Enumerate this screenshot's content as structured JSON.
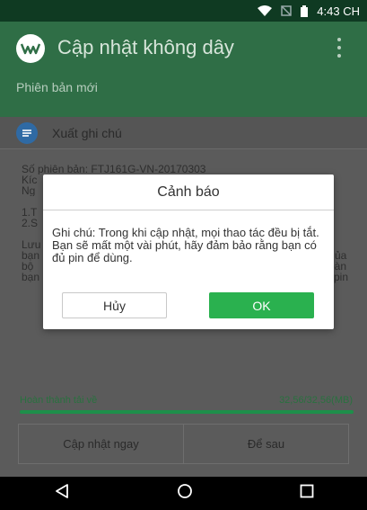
{
  "status_bar": {
    "time": "4:43 CH"
  },
  "app_bar": {
    "title": "Cập nhật không dây",
    "subtitle": "Phiên bản mới"
  },
  "notes": {
    "label": "Xuất ghi chú"
  },
  "info": {
    "lines": [
      "Số phiên bản: FTJ161G-VN-20170303",
      "Kíc",
      "Ng",
      "",
      "1.T",
      "2.S",
      "",
      "Lưu",
      "bạn",
      "bộ",
      "bạn"
    ],
    "right_fragments": [
      "ủa",
      "oàn",
      "pin"
    ]
  },
  "download": {
    "label": "Hoàn thành tải về",
    "value": "32,56/32,56(MB)",
    "progress": 1.0
  },
  "actions": {
    "update_now": "Cập nhật ngay",
    "later": "Để sau"
  },
  "dialog": {
    "title": "Cảnh báo",
    "message": "Ghi chú: Trong khi cập nhật, mọi thao tác đều bị tắt. Bạn sẽ mất một vài phút, hãy đảm bảo rằng bạn có đủ pin để dùng.",
    "cancel_label": "Hủy",
    "ok_label": "OK"
  },
  "colors": {
    "app_bar": "#2f6e46",
    "accent": "#2ab14f",
    "overlay": "#5b5b5b"
  },
  "icons": [
    "wifi-icon",
    "no-sim-icon",
    "battery-icon",
    "app-logo-icon",
    "more-vert-icon",
    "notes-icon",
    "back-icon",
    "home-icon",
    "recents-icon"
  ]
}
